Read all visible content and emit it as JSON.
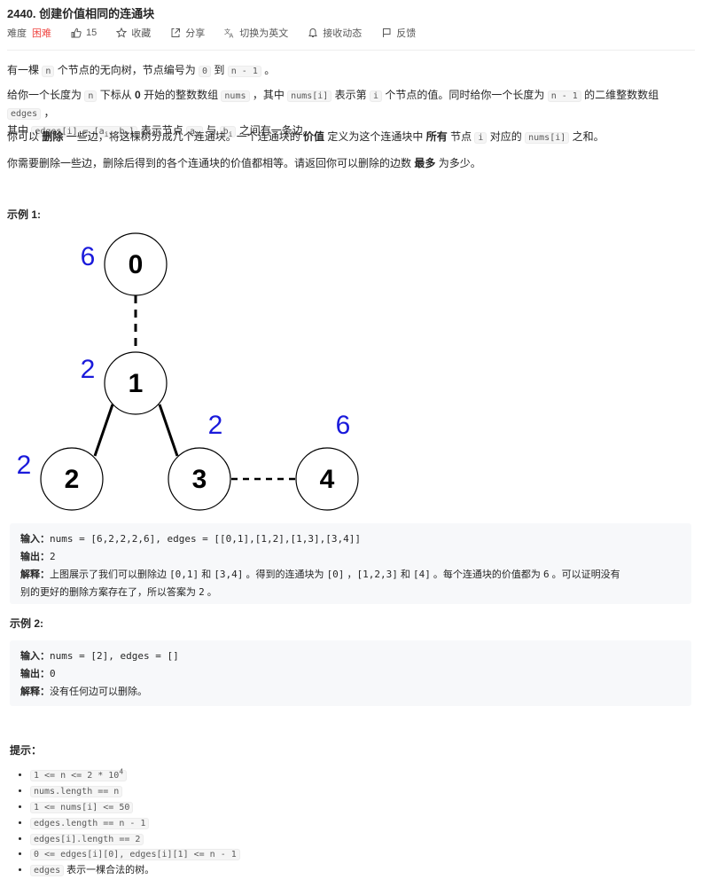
{
  "header": {
    "title": "2440. 创建价值相同的连通块",
    "difficulty_label": "难度",
    "difficulty": "困难",
    "likes": "15",
    "favorite": "收藏",
    "share": "分享",
    "switch_lang": "切换为英文",
    "subscribe": "接收动态",
    "feedback": "反馈"
  },
  "description": {
    "p1_a": "有一棵 ",
    "p1_n": "n",
    "p1_b": " 个节点的无向树，节点编号为 ",
    "p1_0": "0",
    "p1_c": " 到 ",
    "p1_n1": "n - 1",
    "p1_d": " 。",
    "p2_a": "给你一个长度为 ",
    "p2_n": "n",
    "p2_b": " 下标从 ",
    "p2_0": "0",
    "p2_c": " 开始的整数数组 ",
    "p2_nums": "nums",
    "p2_d": " ，其中 ",
    "p2_numsi": "nums[i]",
    "p2_e": " 表示第 ",
    "p2_i": "i",
    "p2_f": " 个节点的值。同时给你一个长度为 ",
    "p2_n1": "n - 1",
    "p2_g": " 的二维整数数组 ",
    "p2_edges": "edges",
    "p2_h": " ，",
    "p2_i2": "其中 ",
    "p2_edgesi": "edges[i] = [a",
    "p2_sub_i": "i",
    "p2_comma_b": ", b",
    "p2_sub_i2": "i",
    "p2_close": "]",
    "p2_j": " 表示节点 ",
    "p2_ai": "a",
    "p2_ai_sub": "i",
    "p2_k": " 与 ",
    "p2_bi": "b",
    "p2_bi_sub": "i",
    "p2_l": " 之间有一条边。",
    "p3_a": "你可以 ",
    "p3_del": "删除",
    "p3_b": " 一些边，将这棵树分成几个连通块。一个连通块的 ",
    "p3_val": "价值",
    "p3_c": " 定义为这个连通块中 ",
    "p3_all": "所有",
    "p3_d": " 节点 ",
    "p3_i": "i",
    "p3_e": " 对应的 ",
    "p3_numsi": "nums[i]",
    "p3_f": " 之和。",
    "p4_a": "你需要删除一些边，删除后得到的各个连通块的价值都相等。请返回你可以删除的边数 ",
    "p4_most": "最多",
    "p4_b": " 为多少。"
  },
  "example1": {
    "heading": "示例 1:",
    "input_label": "输入：",
    "input": "nums = [6,2,2,2,6], edges = [[0,1],[1,2],[1,3],[3,4]]",
    "output_label": "输出：",
    "output": "2",
    "explain_label": "解释：",
    "explain_a": "上图展示了我们可以删除边 ",
    "explain_e1": "[0,1]",
    "explain_b": " 和 ",
    "explain_e2": "[3,4]",
    "explain_c": " 。得到的连通块为 ",
    "explain_c1": "[0]",
    "explain_d": " ，",
    "explain_c2": "[1,2,3]",
    "explain_e": " 和 ",
    "explain_c3": "[4]",
    "explain_f": " 。每个连通块的价值都为 ",
    "explain_6": "6",
    "explain_g": " 。可以证明没有",
    "explain_h": "别的更好的删除方案存在了，所以答案为 ",
    "explain_2": "2",
    "explain_i": " 。",
    "tree": {
      "nodes": [
        {
          "id": "0",
          "value": "6"
        },
        {
          "id": "1",
          "value": "2"
        },
        {
          "id": "2",
          "value": "2"
        },
        {
          "id": "3",
          "value": "2"
        },
        {
          "id": "4",
          "value": "6"
        }
      ]
    }
  },
  "example2": {
    "heading": "示例 2:",
    "input_label": "输入：",
    "input": "nums = [2], edges = []",
    "output_label": "输出：",
    "output": "0",
    "explain_label": "解释：",
    "explain": "没有任何边可以删除。"
  },
  "constraints": {
    "heading": "提示：",
    "items": [
      "1 <= n <= 2 * 10",
      "nums.length == n",
      "1 <= nums[i] <= 50",
      "edges.length == n - 1",
      "edges[i].length == 2",
      "0 <= edges[i][0], edges[i][1] <= n - 1",
      "edges"
    ],
    "item1_sup": "4",
    "item7_tail": " 表示一棵合法的树。"
  },
  "colors": {
    "difficulty": "#ef4743",
    "node_value": "#1a1adb"
  }
}
